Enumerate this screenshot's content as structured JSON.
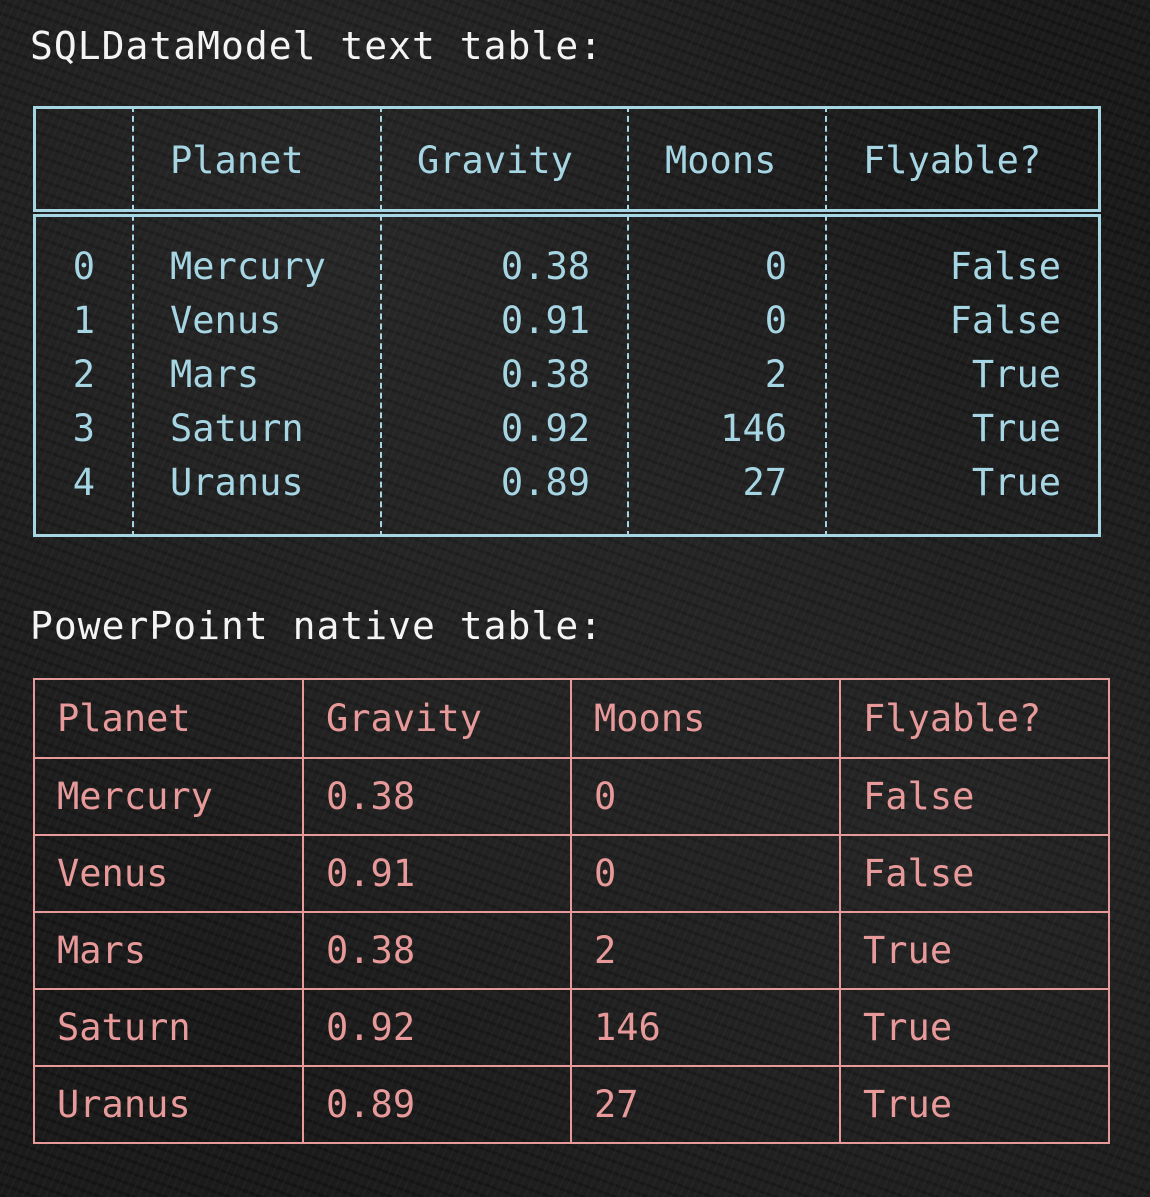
{
  "headings": {
    "text_table": "SQLDataModel text table:",
    "native_table": "PowerPoint native table:"
  },
  "colors": {
    "text_table": "#a6d6e4",
    "native_table": "#e89a9a",
    "heading": "#f4f4f4",
    "background": "#1b1b1b"
  },
  "text_table": {
    "columns": [
      "",
      "Planet",
      "Gravity",
      "Moons",
      "Flyable?"
    ],
    "rows": [
      [
        "0",
        "Mercury",
        "0.38",
        "0",
        "False"
      ],
      [
        "1",
        "Venus",
        "0.91",
        "0",
        "False"
      ],
      [
        "2",
        "Mars",
        "0.38",
        "2",
        "True"
      ],
      [
        "3",
        "Saturn",
        "0.92",
        "146",
        "True"
      ],
      [
        "4",
        "Uranus",
        "0.89",
        "27",
        "True"
      ]
    ]
  },
  "native_table": {
    "columns": [
      "Planet",
      "Gravity",
      "Moons",
      "Flyable?"
    ],
    "rows": [
      [
        "Mercury",
        "0.38",
        "0",
        "False"
      ],
      [
        "Venus",
        "0.91",
        "0",
        "False"
      ],
      [
        "Mars",
        "0.38",
        "2",
        "True"
      ],
      [
        "Saturn",
        "0.92",
        "146",
        "True"
      ],
      [
        "Uranus",
        "0.89",
        "27",
        "True"
      ]
    ]
  },
  "chart_data": [
    {
      "type": "table",
      "columns": [
        "",
        "Planet",
        "Gravity",
        "Moons",
        "Flyable?"
      ],
      "rows": [
        [
          "0",
          "Mercury",
          0.38,
          0,
          "False"
        ],
        [
          "1",
          "Venus",
          0.91,
          0,
          "False"
        ],
        [
          "2",
          "Mars",
          0.38,
          2,
          "True"
        ],
        [
          "3",
          "Saturn",
          0.92,
          146,
          "True"
        ],
        [
          "4",
          "Uranus",
          0.89,
          27,
          "True"
        ]
      ]
    },
    {
      "type": "table",
      "columns": [
        "Planet",
        "Gravity",
        "Moons",
        "Flyable?"
      ],
      "rows": [
        [
          "Mercury",
          0.38,
          0,
          "False"
        ],
        [
          "Venus",
          0.91,
          0,
          "False"
        ],
        [
          "Mars",
          0.38,
          2,
          "True"
        ],
        [
          "Saturn",
          0.92,
          146,
          "True"
        ],
        [
          "Uranus",
          0.89,
          27,
          "True"
        ]
      ]
    }
  ]
}
